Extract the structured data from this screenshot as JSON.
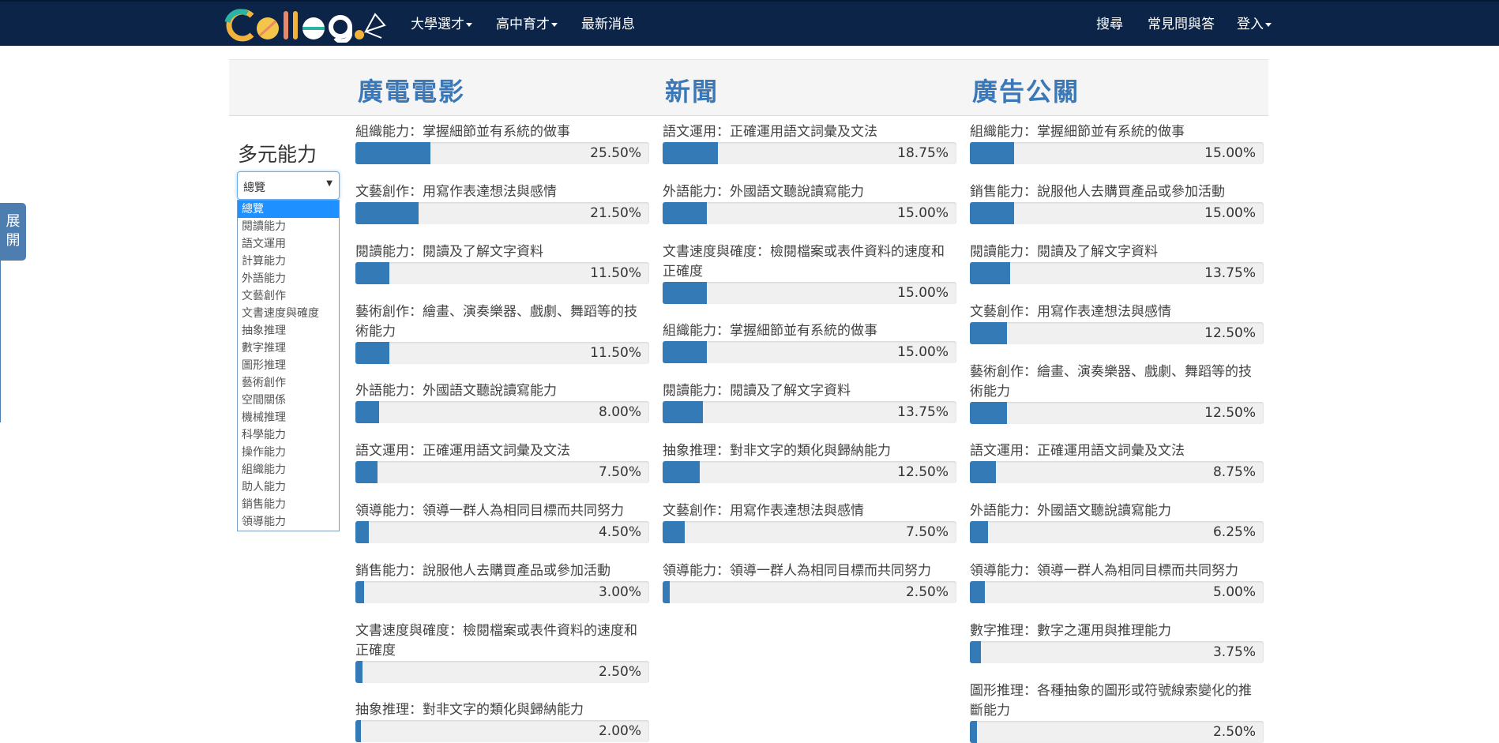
{
  "nav": {
    "logo_text": "Colleg",
    "items": [
      {
        "label": "大學選才",
        "dropdown": true
      },
      {
        "label": "高中育才",
        "dropdown": true
      },
      {
        "label": "最新消息",
        "dropdown": false
      }
    ],
    "right_items": [
      {
        "label": "搜尋",
        "dropdown": false
      },
      {
        "label": "常見問與答",
        "dropdown": false
      },
      {
        "label": "登入",
        "dropdown": true
      }
    ]
  },
  "expand_tab": {
    "label": "展開"
  },
  "panel": {
    "title": "多元能力",
    "select_value": "總覽",
    "options": [
      "總覽",
      "閱讀能力",
      "語文運用",
      "計算能力",
      "外語能力",
      "文藝創作",
      "文書速度與確度",
      "抽象推理",
      "數字推理",
      "圖形推理",
      "藝術創作",
      "空間關係",
      "機械推理",
      "科學能力",
      "操作能力",
      "組織能力",
      "助人能力",
      "銷售能力",
      "領導能力"
    ],
    "selected_index": 0
  },
  "colors": {
    "navbar": "#0b2447",
    "bar_fill": "#337ab7",
    "title": "#3a78b8"
  },
  "columns": [
    {
      "title": "廣電電影",
      "items": [
        {
          "label": "組織能力：掌握細節並有系統的做事",
          "percent": 25.5,
          "value": "25.50%"
        },
        {
          "label": "文藝創作：用寫作表達想法與感情",
          "percent": 21.5,
          "value": "21.50%"
        },
        {
          "label": "閱讀能力：閱讀及了解文字資料",
          "percent": 11.5,
          "value": "11.50%"
        },
        {
          "label": "藝術創作：繪畫、演奏樂器、戲劇、舞蹈等的技術能力",
          "percent": 11.5,
          "value": "11.50%"
        },
        {
          "label": "外語能力：外國語文聽說讀寫能力",
          "percent": 8.0,
          "value": "8.00%"
        },
        {
          "label": "語文運用：正確運用語文詞彙及文法",
          "percent": 7.5,
          "value": "7.50%"
        },
        {
          "label": "領導能力：領導一群人為相同目標而共同努力",
          "percent": 4.5,
          "value": "4.50%"
        },
        {
          "label": "銷售能力：說服他人去購買產品或參加活動",
          "percent": 3.0,
          "value": "3.00%"
        },
        {
          "label": "文書速度與確度：檢閱檔案或表件資料的速度和正確度",
          "percent": 2.5,
          "value": "2.50%"
        },
        {
          "label": "抽象推理：對非文字的類化與歸納能力",
          "percent": 2.0,
          "value": "2.00%"
        }
      ]
    },
    {
      "title": "新聞",
      "items": [
        {
          "label": "語文運用：正確運用語文詞彙及文法",
          "percent": 18.75,
          "value": "18.75%"
        },
        {
          "label": "外語能力：外國語文聽說讀寫能力",
          "percent": 15.0,
          "value": "15.00%"
        },
        {
          "label": "文書速度與確度：檢閱檔案或表件資料的速度和正確度",
          "percent": 15.0,
          "value": "15.00%"
        },
        {
          "label": "組織能力：掌握細節並有系統的做事",
          "percent": 15.0,
          "value": "15.00%"
        },
        {
          "label": "閱讀能力：閱讀及了解文字資料",
          "percent": 13.75,
          "value": "13.75%"
        },
        {
          "label": "抽象推理：對非文字的類化與歸納能力",
          "percent": 12.5,
          "value": "12.50%"
        },
        {
          "label": "文藝創作：用寫作表達想法與感情",
          "percent": 7.5,
          "value": "7.50%"
        },
        {
          "label": "領導能力：領導一群人為相同目標而共同努力",
          "percent": 2.5,
          "value": "2.50%"
        }
      ]
    },
    {
      "title": "廣告公關",
      "items": [
        {
          "label": "組織能力：掌握細節並有系統的做事",
          "percent": 15.0,
          "value": "15.00%"
        },
        {
          "label": "銷售能力：說服他人去購買產品或參加活動",
          "percent": 15.0,
          "value": "15.00%"
        },
        {
          "label": "閱讀能力：閱讀及了解文字資料",
          "percent": 13.75,
          "value": "13.75%"
        },
        {
          "label": "文藝創作：用寫作表達想法與感情",
          "percent": 12.5,
          "value": "12.50%"
        },
        {
          "label": "藝術創作：繪畫、演奏樂器、戲劇、舞蹈等的技術能力",
          "percent": 12.5,
          "value": "12.50%"
        },
        {
          "label": "語文運用：正確運用語文詞彙及文法",
          "percent": 8.75,
          "value": "8.75%"
        },
        {
          "label": "外語能力：外國語文聽說讀寫能力",
          "percent": 6.25,
          "value": "6.25%"
        },
        {
          "label": "領導能力：領導一群人為相同目標而共同努力",
          "percent": 5.0,
          "value": "5.00%"
        },
        {
          "label": "數字推理：數字之運用與推理能力",
          "percent": 3.75,
          "value": "3.75%"
        },
        {
          "label": "圖形推理：各種抽象的圖形或符號線索變化的推斷能力",
          "percent": 2.5,
          "value": "2.50%"
        }
      ]
    }
  ]
}
